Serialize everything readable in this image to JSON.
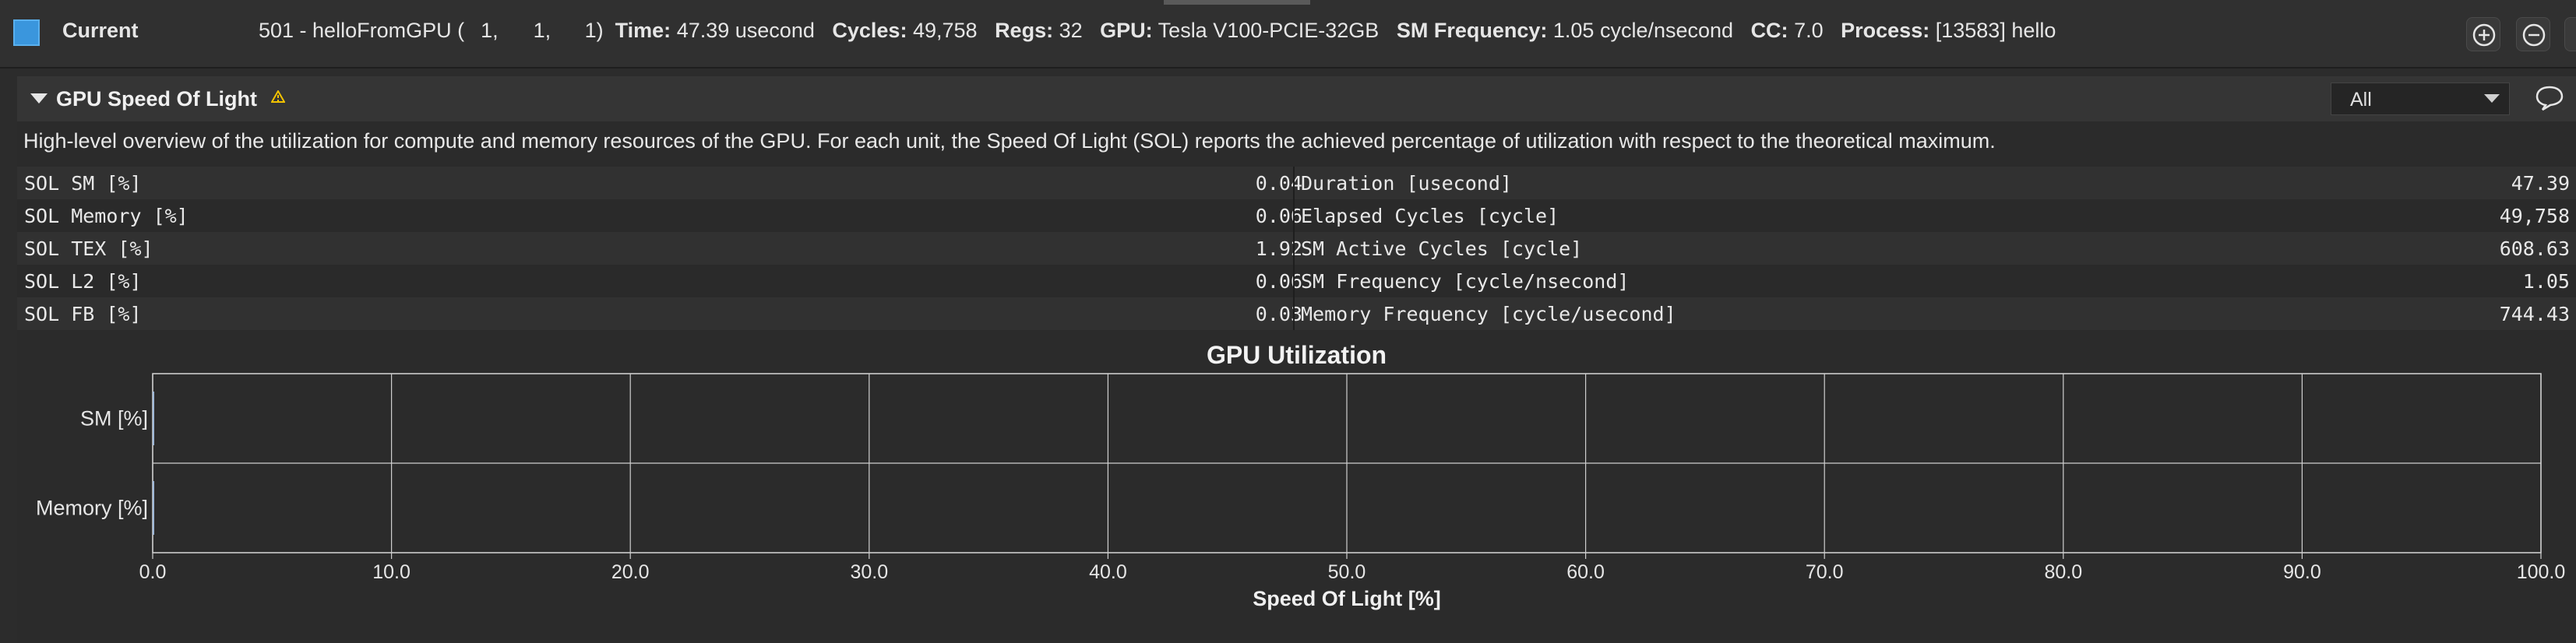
{
  "topbar": {
    "current_label": "Current",
    "kernel": "501 - helloFromGPU (",
    "grid": [
      "1,",
      "1,",
      "1)"
    ],
    "time_label": "Time:",
    "time_value": "47.39 usecond",
    "cycles_label": "Cycles:",
    "cycles_value": "49,758",
    "regs_label": "Regs:",
    "regs_value": "32",
    "gpu_label": "GPU:",
    "gpu_value": "Tesla V100-PCIE-32GB",
    "smfreq_label": "SM Frequency:",
    "smfreq_value": "1.05 cycle/nsecond",
    "cc_label": "CC:",
    "cc_value": "7.0",
    "process_label": "Process:",
    "process_value": "[13583] hello",
    "icons": [
      "zoom-in-icon",
      "zoom-out-icon"
    ]
  },
  "section": {
    "title": "GPU Speed Of Light",
    "filter_value": "All",
    "description": "High-level overview of the utilization for compute and memory resources of the GPU. For each unit, the Speed Of Light (SOL) reports the achieved percentage of utilization with respect to the theoretical maximum.",
    "metrics": [
      {
        "l_name": "SOL SM [%]",
        "l_value": "0.04",
        "r_name": "Duration [usecond]",
        "r_value": "47.39"
      },
      {
        "l_name": "SOL Memory [%]",
        "l_value": "0.06",
        "r_name": "Elapsed Cycles [cycle]",
        "r_value": "49,758"
      },
      {
        "l_name": "SOL TEX [%]",
        "l_value": "1.92",
        "r_name": "SM Active Cycles [cycle]",
        "r_value": "608.63"
      },
      {
        "l_name": "SOL L2 [%]",
        "l_value": "0.06",
        "r_name": "SM Frequency [cycle/nsecond]",
        "r_value": "1.05"
      },
      {
        "l_name": "SOL FB [%]",
        "l_value": "0.03",
        "r_name": "Memory Frequency [cycle/usecond]",
        "r_value": "744.43"
      }
    ]
  },
  "chart_data": {
    "type": "bar",
    "orientation": "horizontal",
    "title": "GPU Utilization",
    "xlabel": "Speed Of Light [%]",
    "ylabel": "",
    "categories": [
      "SM [%]",
      "Memory [%]"
    ],
    "values": [
      0.04,
      0.06
    ],
    "xlim": [
      0,
      100
    ],
    "xticks": [
      "0.0",
      "10.0",
      "20.0",
      "30.0",
      "40.0",
      "50.0",
      "60.0",
      "70.0",
      "80.0",
      "90.0",
      "100.0"
    ],
    "grid": true,
    "bar_color": "#9fb8d8"
  },
  "colors": {
    "accent": "#3a96dd",
    "warning": "#f2c200"
  }
}
